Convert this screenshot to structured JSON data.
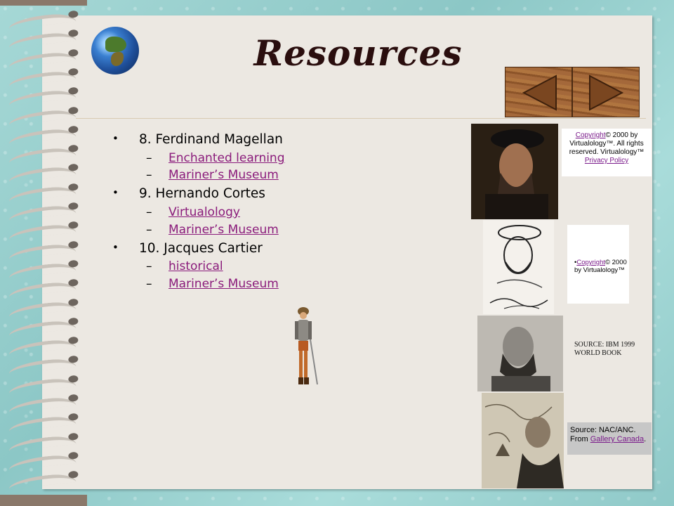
{
  "page": {
    "title": "Resources"
  },
  "items": [
    {
      "label": "8. Ferdinand Magellan",
      "links": [
        "Enchanted learning",
        "Mariner’s Museum"
      ]
    },
    {
      "label": "9. Hernando Cortes",
      "links": [
        "Virtualology",
        "Mariner’s Museum"
      ]
    },
    {
      "label": "10. Jacques Cartier",
      "links": [
        "historical",
        "Mariner’s Museum"
      ]
    }
  ],
  "captions": {
    "magellan_1": {
      "link1": "Copyright",
      "text1": "© 2000 by Virtualology™. All rights reserved. Virtualology™ ",
      "link2": "Privacy Policy"
    },
    "magellan_2": {
      "prefix": "•",
      "link": "Copyright",
      "text": "© 2000 by Virtualology™"
    },
    "magellan_3": {
      "text": "SOURCE: IBM 1999 WORLD BOOK"
    },
    "cartier": {
      "text1": "Source: NAC/ANC. From ",
      "link": "Gallery Canada",
      "text2": "."
    }
  },
  "icons": {
    "globe": "globe-icon",
    "prev": "left-triangle-icon",
    "next": "right-triangle-icon"
  },
  "colors": {
    "link": "#8a1b7b",
    "paper": "#ece8e2",
    "nav_wood": "#a4683a"
  }
}
